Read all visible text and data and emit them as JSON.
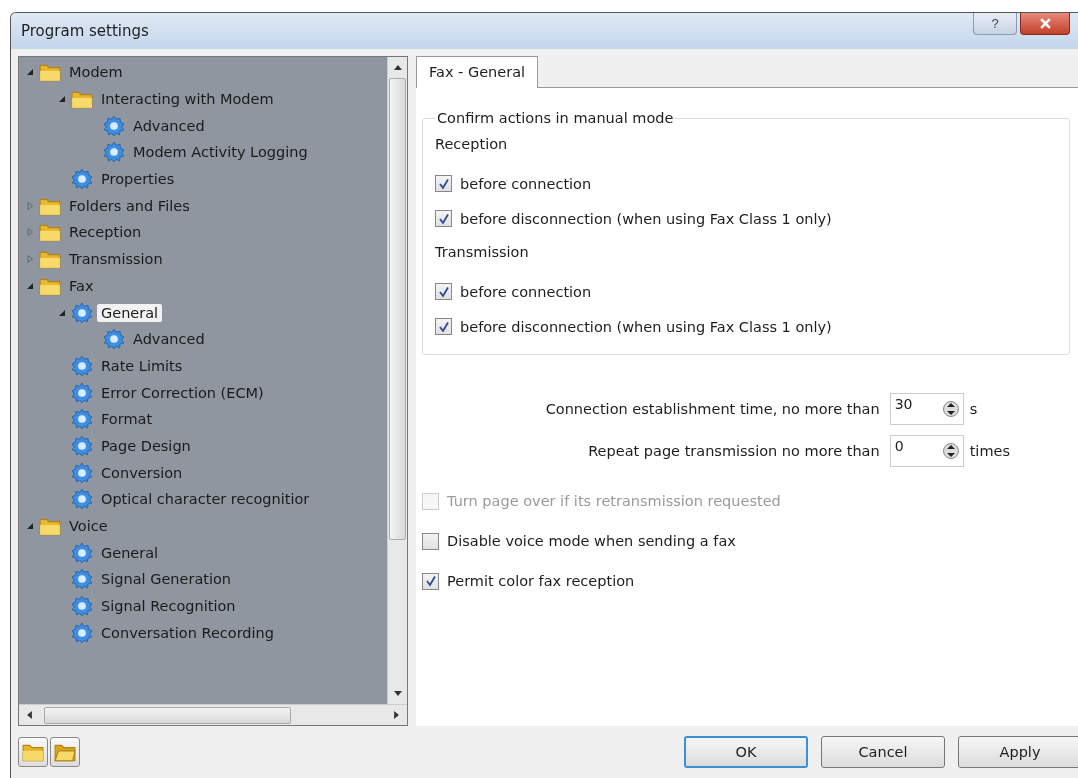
{
  "window": {
    "title": "Program settings",
    "help_label": "?"
  },
  "tree": [
    {
      "label": "Modem",
      "kind": "folder",
      "expanded": true,
      "selected": false,
      "children": [
        {
          "label": "Interacting with Modem",
          "kind": "folder",
          "expanded": true,
          "selected": false,
          "children": [
            {
              "label": "Advanced",
              "kind": "gear",
              "selected": false
            },
            {
              "label": "Modem Activity Logging",
              "kind": "gear",
              "selected": false
            }
          ]
        },
        {
          "label": "Properties",
          "kind": "gear",
          "selected": false
        }
      ]
    },
    {
      "label": "Folders and Files",
      "kind": "folder",
      "expanded": false,
      "selected": false
    },
    {
      "label": "Reception",
      "kind": "folder",
      "expanded": false,
      "selected": false
    },
    {
      "label": "Transmission",
      "kind": "folder",
      "expanded": false,
      "selected": false
    },
    {
      "label": "Fax",
      "kind": "folder",
      "expanded": true,
      "selected": false,
      "children": [
        {
          "label": "General",
          "kind": "gear",
          "expanded": true,
          "selected": true,
          "children": [
            {
              "label": "Advanced",
              "kind": "gear",
              "selected": false
            }
          ]
        },
        {
          "label": "Rate Limits",
          "kind": "gear",
          "selected": false
        },
        {
          "label": "Error Correction (ECM)",
          "kind": "gear",
          "selected": false
        },
        {
          "label": "Format",
          "kind": "gear",
          "selected": false
        },
        {
          "label": "Page Design",
          "kind": "gear",
          "selected": false
        },
        {
          "label": "Conversion",
          "kind": "gear",
          "selected": false
        },
        {
          "label": "Optical character recognitior",
          "kind": "gear",
          "selected": false
        }
      ]
    },
    {
      "label": "Voice",
      "kind": "folder",
      "expanded": true,
      "selected": false,
      "children": [
        {
          "label": "General",
          "kind": "gear",
          "selected": false
        },
        {
          "label": "Signal Generation",
          "kind": "gear",
          "selected": false
        },
        {
          "label": "Signal Recognition",
          "kind": "gear",
          "selected": false
        },
        {
          "label": "Conversation Recording",
          "kind": "gear",
          "selected": false
        }
      ]
    }
  ],
  "tabs": [
    {
      "label": "Fax - General",
      "selected": true
    }
  ],
  "group": {
    "title": "Confirm actions in manual mode",
    "sections": [
      {
        "heading": "Reception",
        "options": [
          {
            "label": "before connection",
            "checked": true
          },
          {
            "label": "before disconnection (when using Fax Class 1 only)",
            "checked": true
          }
        ]
      },
      {
        "heading": "Transmission",
        "options": [
          {
            "label": "before connection",
            "checked": true
          },
          {
            "label": "before disconnection (when using Fax Class 1 only)",
            "checked": true
          }
        ]
      }
    ]
  },
  "spinners": [
    {
      "label": "Connection establishment time, no more than",
      "value": "30",
      "unit": "s"
    },
    {
      "label": "Repeat page transmission no more than",
      "value": "0",
      "unit": "times"
    }
  ],
  "options": [
    {
      "label": "Turn page over if its retransmission requested",
      "checked": false,
      "disabled": true
    },
    {
      "label": "Disable voice mode when sending a fax",
      "checked": false,
      "disabled": false
    },
    {
      "label": "Permit color fax reception",
      "checked": true,
      "disabled": false
    }
  ],
  "buttons": [
    {
      "label": "OK",
      "default": true
    },
    {
      "label": "Cancel",
      "default": false
    },
    {
      "label": "Apply",
      "default": false
    }
  ]
}
